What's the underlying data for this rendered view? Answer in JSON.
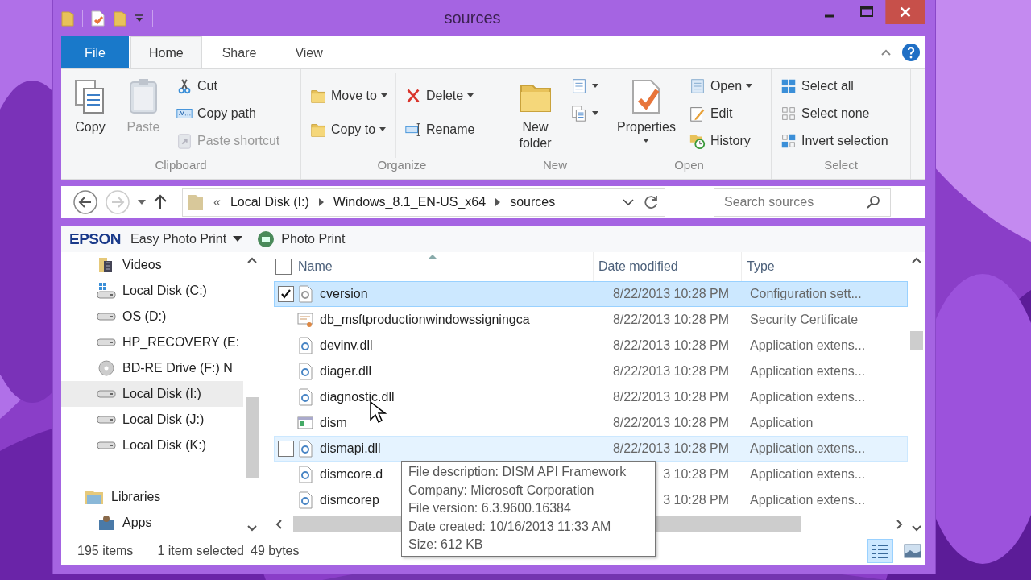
{
  "window": {
    "title": "sources"
  },
  "ribbon": {
    "tabs": [
      {
        "label": "File",
        "kind": "file",
        "selected": false
      },
      {
        "label": "Home",
        "kind": "tab",
        "selected": true
      },
      {
        "label": "Share",
        "kind": "tab",
        "selected": false
      },
      {
        "label": "View",
        "kind": "tab",
        "selected": false
      }
    ],
    "groups": [
      {
        "label": "Clipboard",
        "columns": [
          [
            {
              "label": "Copy",
              "kind": "large",
              "disabled": false,
              "dropdown": false
            }
          ],
          [
            {
              "label": "Paste",
              "kind": "large",
              "disabled": true,
              "dropdown": false
            }
          ],
          [
            {
              "label": "Cut",
              "kind": "small",
              "disabled": false,
              "dropdown": false
            },
            {
              "label": "Copy path",
              "kind": "small",
              "disabled": false,
              "dropdown": false
            },
            {
              "label": "Paste shortcut",
              "kind": "small",
              "disabled": true,
              "dropdown": false
            }
          ]
        ]
      },
      {
        "label": "Organize",
        "columns": [
          [
            {
              "label": "Move to",
              "kind": "small",
              "disabled": false,
              "dropdown": true
            },
            {
              "label": "Copy to",
              "kind": "small",
              "disabled": false,
              "dropdown": true
            }
          ],
          [
            {
              "label": "Delete",
              "kind": "small",
              "disabled": false,
              "dropdown": true
            },
            {
              "label": "Rename",
              "kind": "small",
              "disabled": false,
              "dropdown": false
            }
          ]
        ]
      },
      {
        "label": "New",
        "columns": [
          [
            {
              "label": "New folder",
              "kind": "large",
              "disabled": false,
              "dropdown": false
            }
          ],
          [
            {
              "kind": "icon",
              "disabled": false,
              "dropdown": true
            },
            {
              "kind": "icon",
              "disabled": false,
              "dropdown": true
            }
          ]
        ]
      },
      {
        "label": "Open",
        "columns": [
          [
            {
              "label": "Properties",
              "kind": "large",
              "disabled": false,
              "dropdown": true
            }
          ],
          [
            {
              "label": "Open",
              "kind": "small",
              "disabled": false,
              "dropdown": true
            },
            {
              "label": "Edit",
              "kind": "small",
              "disabled": false,
              "dropdown": false
            },
            {
              "label": "History",
              "kind": "small",
              "disabled": false,
              "dropdown": false
            }
          ]
        ]
      },
      {
        "label": "Select",
        "columns": [
          [
            {
              "label": "Select all",
              "kind": "small",
              "disabled": false,
              "dropdown": false
            },
            {
              "label": "Select none",
              "kind": "small",
              "disabled": false,
              "dropdown": false
            },
            {
              "label": "Invert selection",
              "kind": "small",
              "disabled": false,
              "dropdown": false
            }
          ]
        ]
      }
    ]
  },
  "address": {
    "crumbs": [
      "Local Disk (I:)",
      "Windows_8.1_EN-US_x64",
      "sources"
    ],
    "overflow": "«",
    "forward_disabled": true,
    "search": {
      "placeholder": "Search sources"
    }
  },
  "epson_bar": {
    "logo": "EPSON",
    "items": [
      {
        "label": "Easy Photo Print",
        "dropdown": true
      },
      {
        "label": "Photo Print",
        "dropdown": false
      }
    ]
  },
  "navigation": {
    "items": [
      {
        "label": "Videos",
        "selected": false
      },
      {
        "label": "Local Disk (C:)",
        "selected": false
      },
      {
        "label": "OS (D:)",
        "selected": false
      },
      {
        "label": "HP_RECOVERY (E:",
        "selected": false
      },
      {
        "label": "BD-RE Drive (F:) N",
        "selected": false
      },
      {
        "label": "Local Disk (I:)",
        "selected": true
      },
      {
        "label": "Local Disk (J:)",
        "selected": false
      },
      {
        "label": "Local Disk (K:)",
        "selected": false
      }
    ],
    "libraries": {
      "label": "Libraries",
      "children": [
        {
          "label": "Apps",
          "selected": false
        }
      ]
    }
  },
  "file_list": {
    "select_all_checked": false,
    "columns": [
      "Name",
      "Date modified",
      "Type"
    ],
    "rows": [
      {
        "name": "cversion",
        "date": "8/22/2013 10:28 PM",
        "type": "Configuration sett...",
        "selected": true,
        "hovered": false
      },
      {
        "name": "db_msftproductionwindowssigningca",
        "date": "8/22/2013 10:28 PM",
        "type": "Security Certificate",
        "selected": false,
        "hovered": false
      },
      {
        "name": "devinv.dll",
        "date": "8/22/2013 10:28 PM",
        "type": "Application extens...",
        "selected": false,
        "hovered": false
      },
      {
        "name": "diager.dll",
        "date": "8/22/2013 10:28 PM",
        "type": "Application extens...",
        "selected": false,
        "hovered": false
      },
      {
        "name": "diagnostic.dll",
        "date": "8/22/2013 10:28 PM",
        "type": "Application extens...",
        "selected": false,
        "hovered": false
      },
      {
        "name": "dism",
        "date": "8/22/2013 10:28 PM",
        "type": "Application",
        "selected": false,
        "hovered": false
      },
      {
        "name": "dismapi.dll",
        "date": "8/22/2013 10:28 PM",
        "type": "Application extens...",
        "selected": false,
        "hovered": true
      },
      {
        "name": "dismcore.d",
        "date": "3 10:28 PM",
        "type": "Application extens...",
        "selected": false,
        "hovered": false
      },
      {
        "name": "dismcorep",
        "date": "3 10:28 PM",
        "type": "Application extens...",
        "selected": false,
        "hovered": false
      }
    ]
  },
  "tooltip": [
    "File description: DISM API Framework",
    "Company: Microsoft Corporation",
    "File version: 6.3.9600.16384",
    "Date created: 10/16/2013 11:33 AM",
    "Size: 612 KB"
  ],
  "status_bar": {
    "item_count": "195 items",
    "selection": "1 item selected",
    "size": "49 bytes",
    "views": [
      {
        "kind": "details",
        "selected": true
      },
      {
        "kind": "large_icons",
        "selected": false
      }
    ]
  }
}
